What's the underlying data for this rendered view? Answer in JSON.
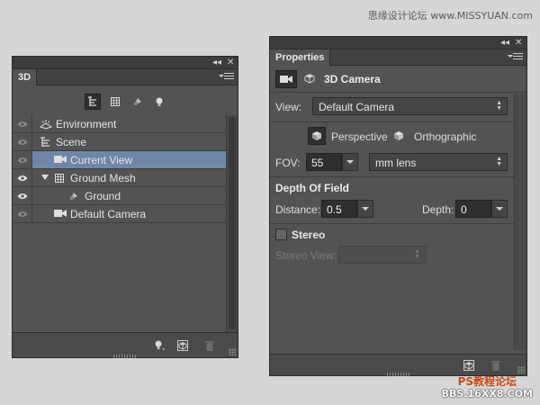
{
  "watermark": {
    "top": "思缘设计论坛 www.MISSYUAN.com",
    "bottom_line1": "PS教程论坛",
    "bottom_line2": "BBS.16XX8.COM"
  },
  "panel_3d": {
    "tab_label": "3D",
    "filter_icons": [
      "scene-filter-icon",
      "mesh-filter-icon",
      "material-filter-icon",
      "light-filter-icon"
    ],
    "layers": [
      {
        "label": "Environment",
        "icon": "environment-icon",
        "visible_eye": "dim",
        "indent": 0,
        "expander": false,
        "selected": false
      },
      {
        "label": "Scene",
        "icon": "scene-icon",
        "visible_eye": "dim",
        "indent": 0,
        "expander": false,
        "selected": false
      },
      {
        "label": "Current View",
        "icon": "camera-icon",
        "visible_eye": "dim",
        "indent": 1,
        "expander": false,
        "selected": true
      },
      {
        "label": "Ground Mesh",
        "icon": "mesh-icon",
        "visible_eye": "bright",
        "indent": 1,
        "expander": true,
        "selected": false
      },
      {
        "label": "Ground",
        "icon": "material-icon",
        "visible_eye": "bright",
        "indent": 2,
        "expander": false,
        "selected": false
      },
      {
        "label": "Default Camera",
        "icon": "camera-icon",
        "visible_eye": "dim",
        "indent": 1,
        "expander": false,
        "selected": false
      }
    ],
    "bottom_icons": [
      "add-light-icon",
      "render-icon",
      "delete-icon"
    ]
  },
  "properties": {
    "tab_label": "Properties",
    "title": "3D Camera",
    "view_label": "View:",
    "view_value": "Default Camera",
    "perspective_label": "Perspective",
    "orthographic_label": "Orthographic",
    "fov_label": "FOV:",
    "fov_value": "55",
    "fov_unit": "mm lens",
    "dof_title": "Depth Of Field",
    "distance_label": "Distance:",
    "distance_value": "0.5",
    "depth_label": "Depth:",
    "depth_value": "0",
    "stereo_label": "Stereo",
    "stereo_view_label": "Stereo View:",
    "stereo_view_value": ""
  },
  "colors": {
    "panel_bg": "#535353",
    "selection": "#6f86a8",
    "page_bg": "#d6d6d6"
  }
}
